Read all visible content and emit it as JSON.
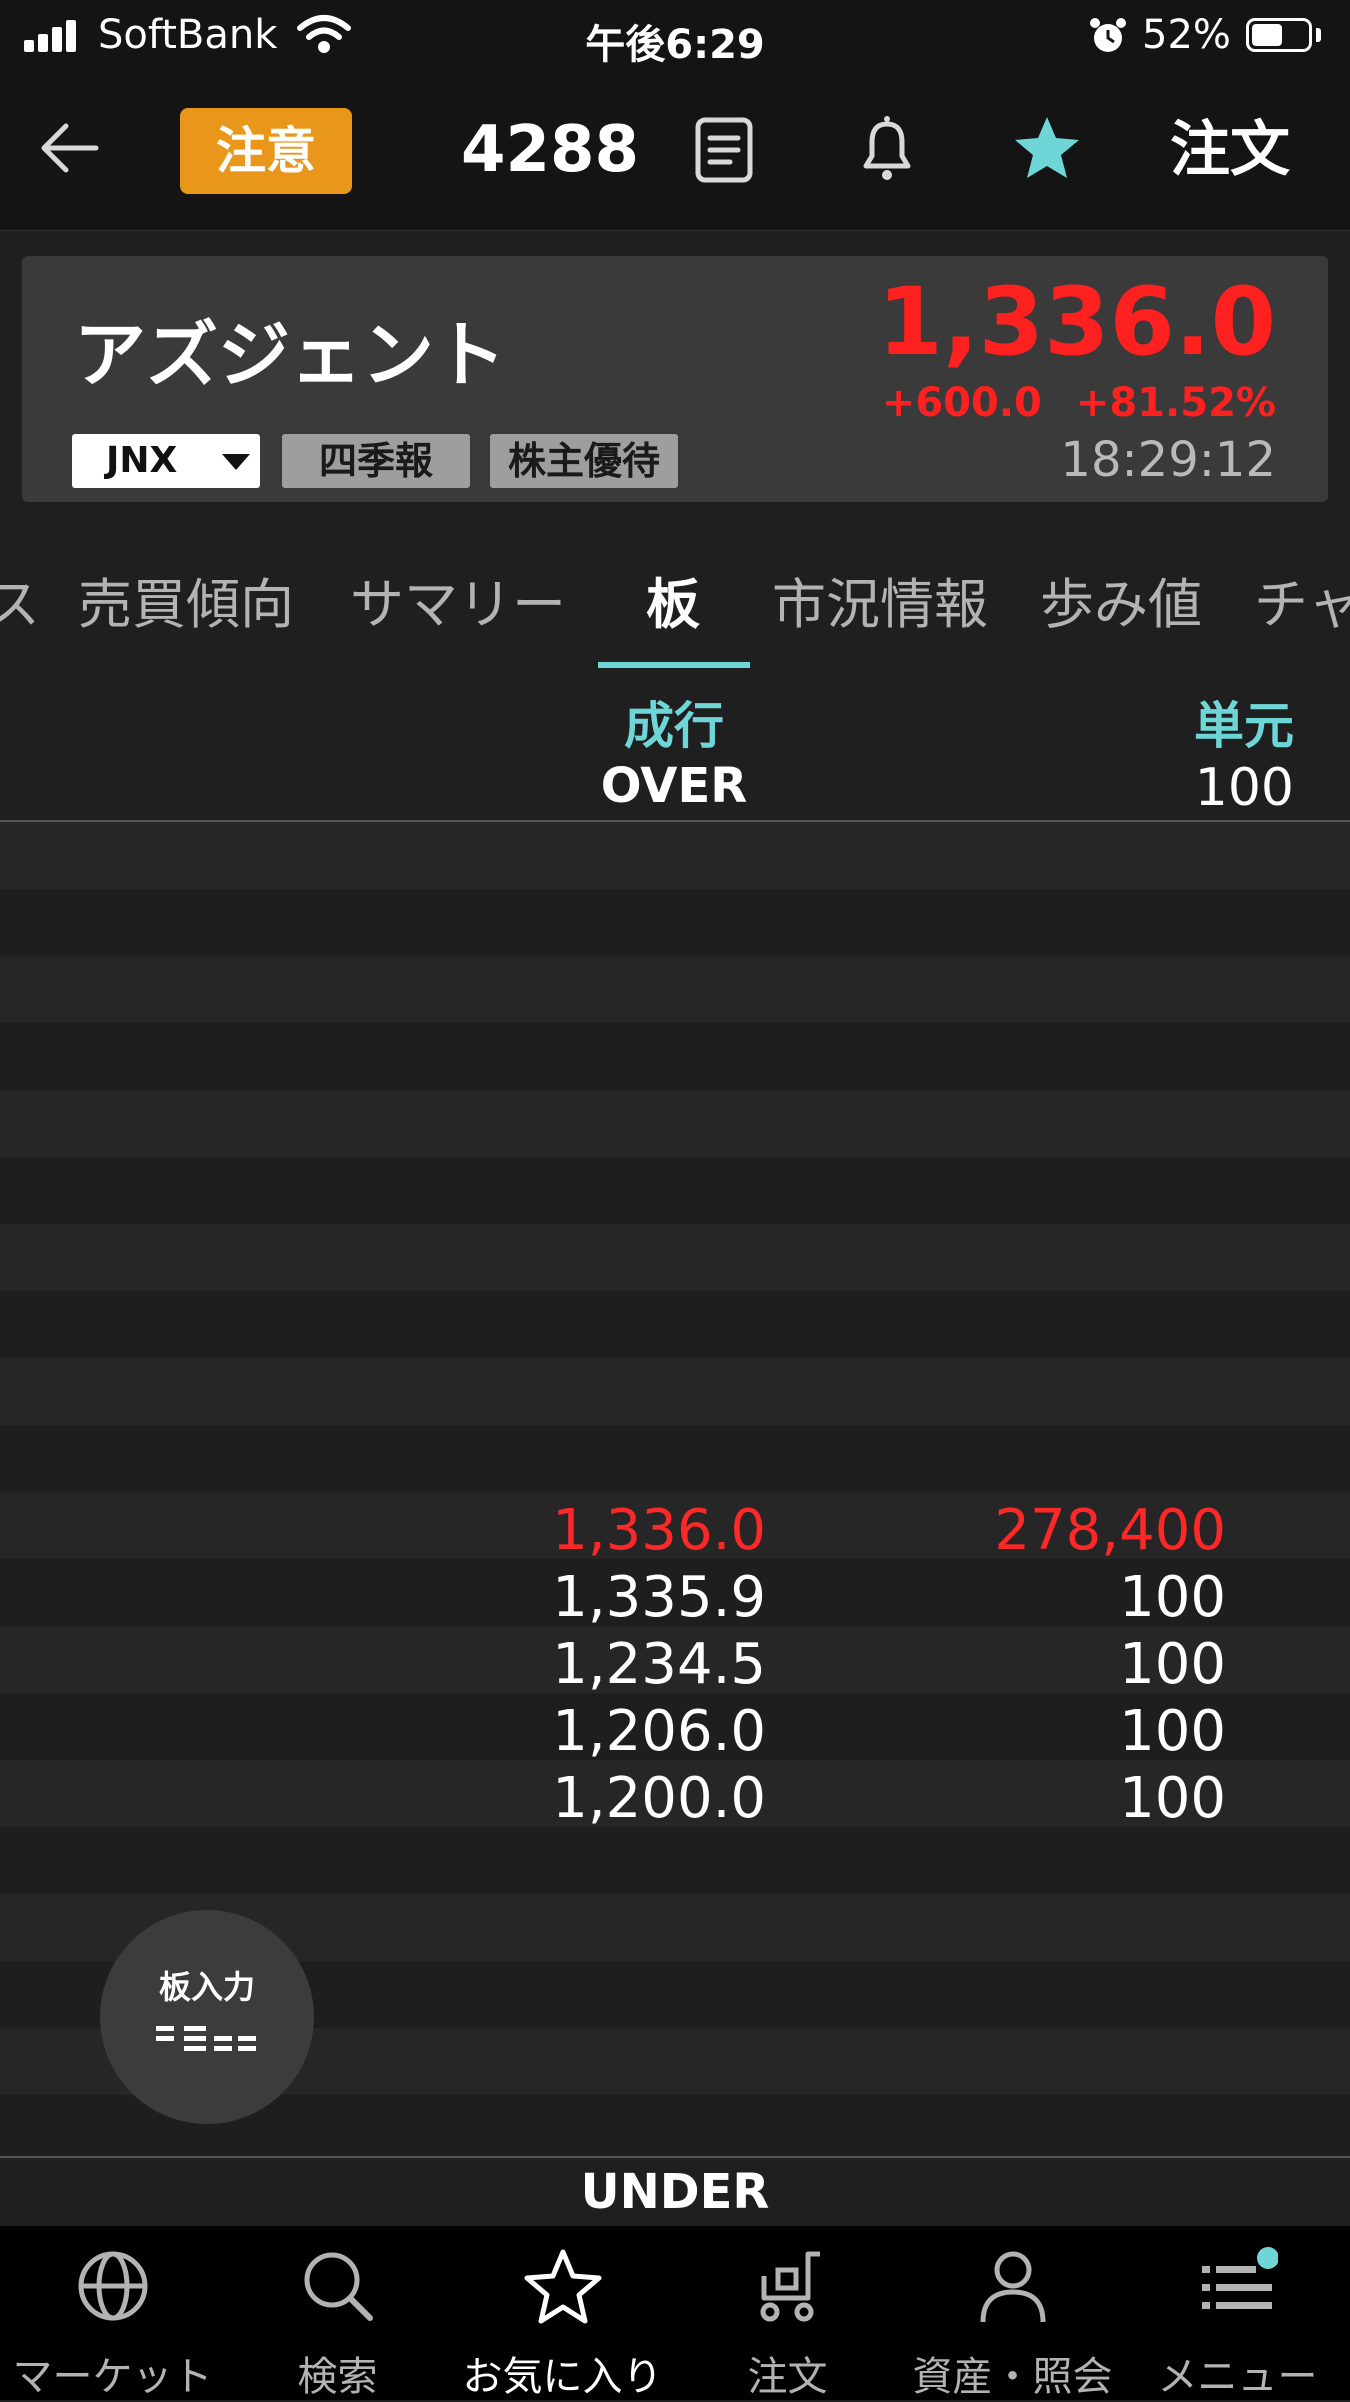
{
  "status_bar": {
    "carrier": "SoftBank",
    "time": "午後6:29",
    "battery_percent": "52%"
  },
  "nav": {
    "caution_badge": "注意",
    "stock_code": "4288",
    "order_label": "注文",
    "accent_color": "#6fd6d8",
    "caution_color": "#e8971a"
  },
  "stock": {
    "name": "アズジェント",
    "price": "1,336.0",
    "change": "+600.0",
    "change_percent": "+81.52%",
    "time": "18:29:12",
    "market": "JNX",
    "tags": [
      "四季報",
      "株主優待"
    ],
    "price_color": "#ff2020"
  },
  "tabs": [
    "ス",
    "売買傾向",
    "サマリー",
    "板",
    "市況情報",
    "歩み値",
    "チャ"
  ],
  "active_tab_index": 3,
  "board": {
    "market_order_label": "成行",
    "over_label": "OVER",
    "unit_label": "単元",
    "unit_value": "100",
    "under_label": "UNDER",
    "rows": [
      {
        "price": "",
        "qty": ""
      },
      {
        "price": "",
        "qty": ""
      },
      {
        "price": "",
        "qty": ""
      },
      {
        "price": "",
        "qty": ""
      },
      {
        "price": "",
        "qty": ""
      },
      {
        "price": "",
        "qty": ""
      },
      {
        "price": "",
        "qty": ""
      },
      {
        "price": "",
        "qty": ""
      },
      {
        "price": "",
        "qty": ""
      },
      {
        "price": "",
        "qty": ""
      },
      {
        "price": "1,336.0",
        "qty": "278,400",
        "highlight": true
      },
      {
        "price": "1,335.9",
        "qty": "100"
      },
      {
        "price": "1,234.5",
        "qty": "100"
      },
      {
        "price": "1,206.0",
        "qty": "100"
      },
      {
        "price": "1,200.0",
        "qty": "100"
      },
      {
        "price": "",
        "qty": ""
      },
      {
        "price": "",
        "qty": ""
      },
      {
        "price": "",
        "qty": ""
      },
      {
        "price": "",
        "qty": ""
      },
      {
        "price": "",
        "qty": ""
      }
    ],
    "board_input_label": "板入力"
  },
  "tab_bar": {
    "items": [
      {
        "label": "マーケット",
        "icon": "globe-icon"
      },
      {
        "label": "検索",
        "icon": "search-icon"
      },
      {
        "label": "お気に入り",
        "icon": "star-outline-icon"
      },
      {
        "label": "注文",
        "icon": "cart-icon"
      },
      {
        "label": "資産・照会",
        "icon": "person-icon"
      },
      {
        "label": "メニュー",
        "icon": "menu-icon"
      }
    ],
    "active_index": 2
  }
}
